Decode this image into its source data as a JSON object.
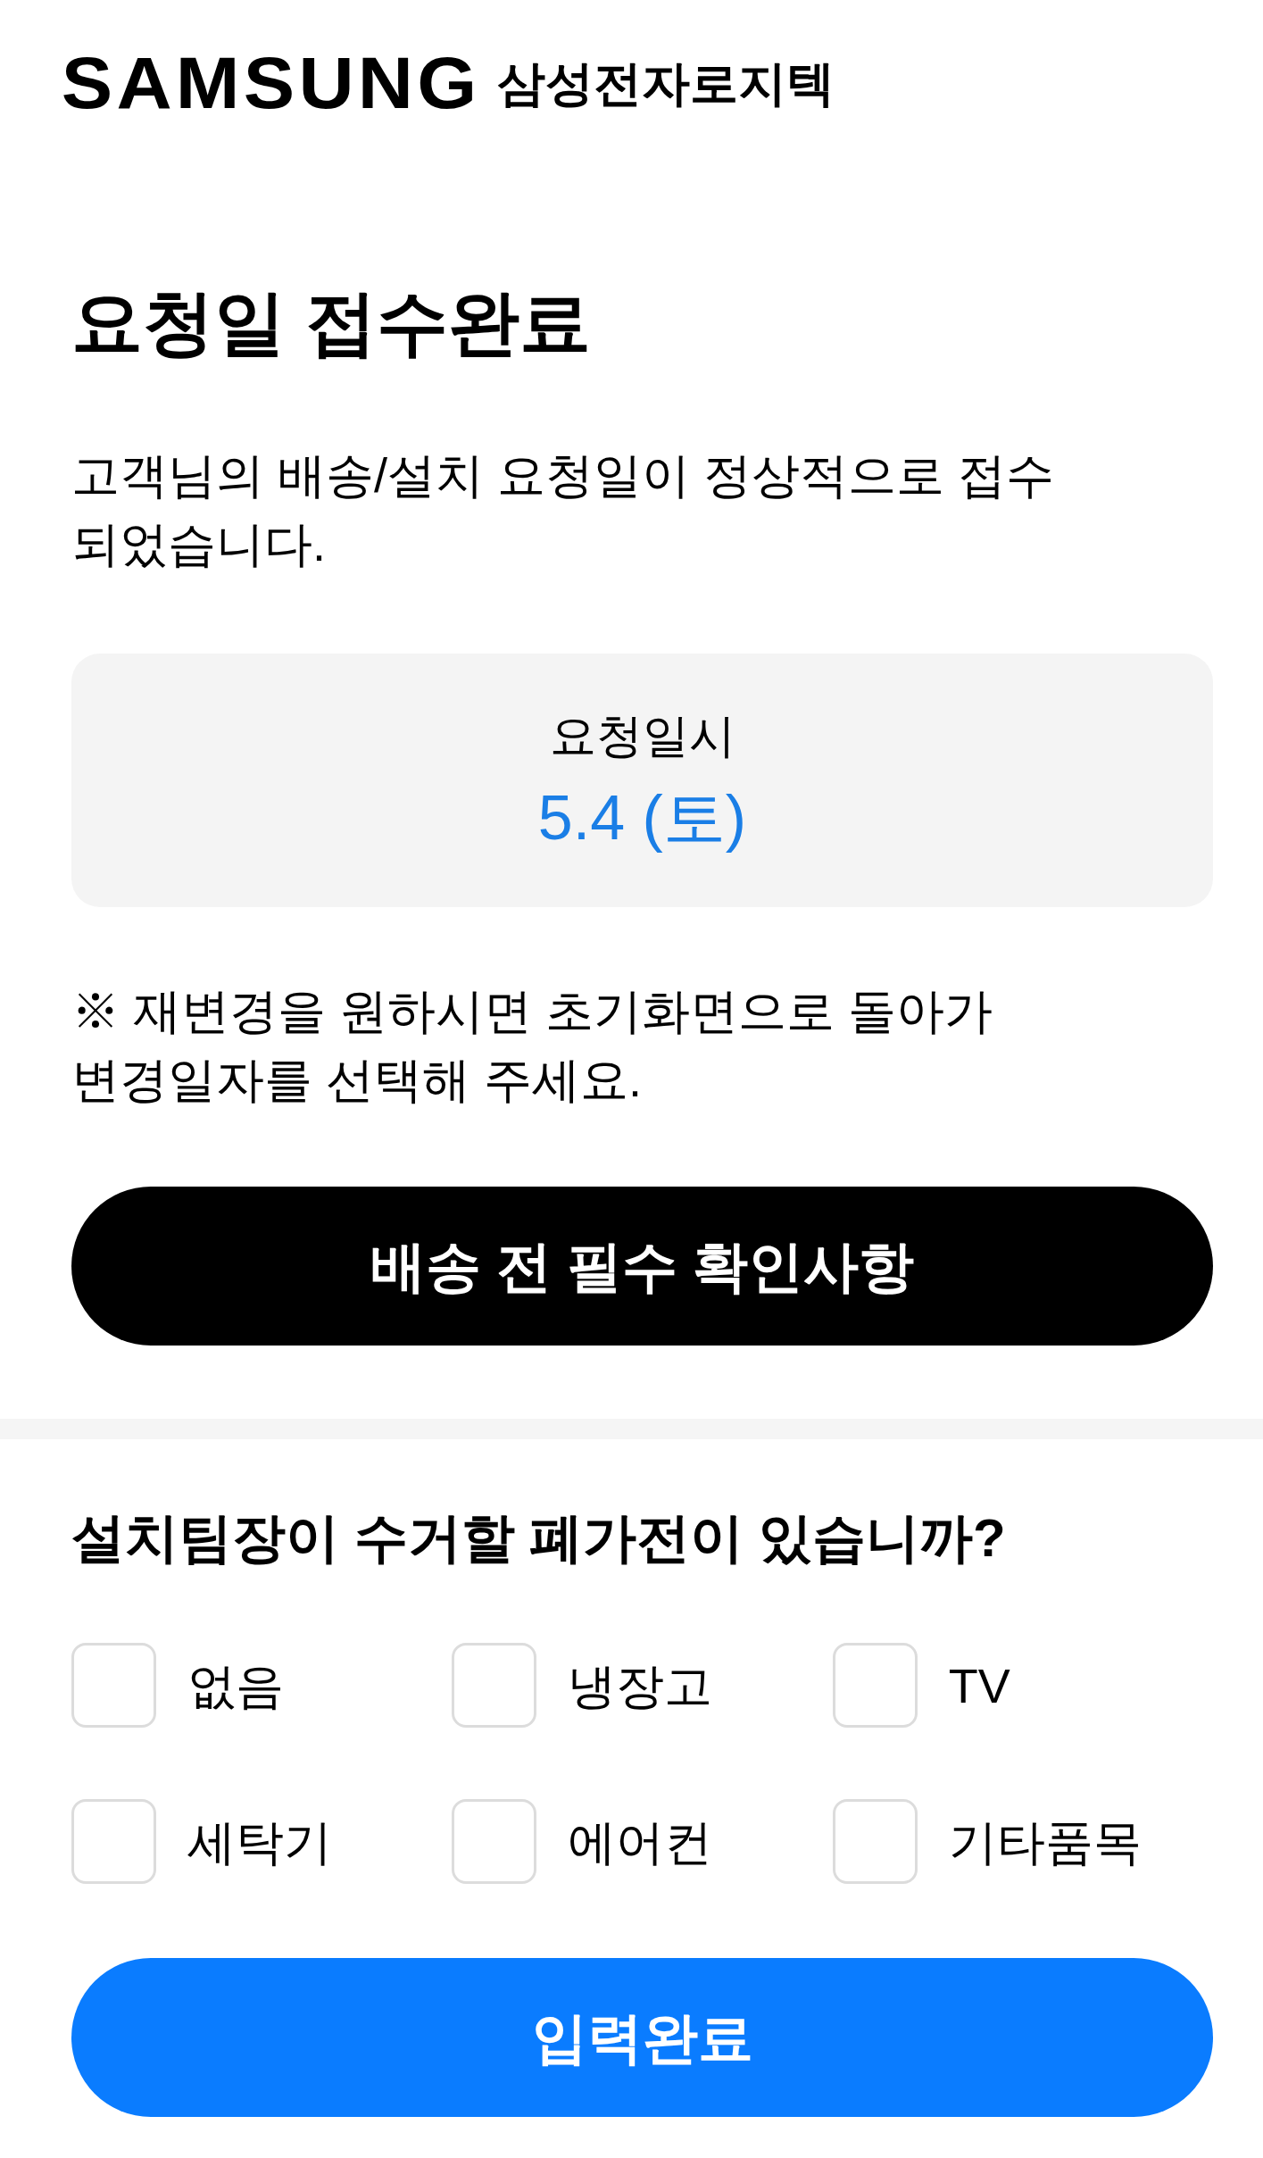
{
  "brand": {
    "logo": "SAMSUNG",
    "name": "삼성전자로지텍"
  },
  "title": "요청일 접수완료",
  "message": "고객님의 배송/설치 요청일이 정상적으로 접수 되었습니다.",
  "request_card": {
    "label": "요청일시",
    "date": "5.4 (토)"
  },
  "note": "※ 재변경을 원하시면 초기화면으로 돌아가 변경일자를 선택해 주세요.",
  "check_button": "배송 전 필수 확인사항",
  "question": "설치팀장이 수거할 폐가전이 있습니까?",
  "options": [
    {
      "label": "없음",
      "checked": false
    },
    {
      "label": "냉장고",
      "checked": false
    },
    {
      "label": "TV",
      "checked": false
    },
    {
      "label": "세탁기",
      "checked": false
    },
    {
      "label": "에어컨",
      "checked": false
    },
    {
      "label": "기타품목",
      "checked": false
    }
  ],
  "submit_button": "입력완료"
}
